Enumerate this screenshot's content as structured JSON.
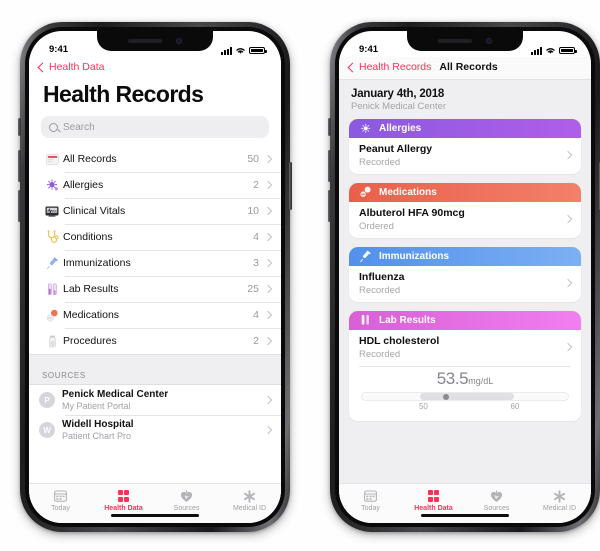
{
  "status_bar": {
    "time": "9:41",
    "signal": "cellular-bars-icon",
    "wifi": "wifi-icon",
    "battery": "battery-icon"
  },
  "theme": {
    "accent": "#fc3158",
    "bg": "#efeff2",
    "allergies": "#9b5de5",
    "medications": "#ef6f52",
    "immunizations": "#5b9bf0",
    "lab_results": "#e46fe0"
  },
  "left_phone": {
    "nav": {
      "back_label": "Health Data",
      "back_icon": "chevron-left-icon"
    },
    "title": "Health Records",
    "search": {
      "placeholder": "Search",
      "icon": "search-icon"
    },
    "categories": [
      {
        "label": "All Records",
        "count": "50",
        "icon": "records-card-icon"
      },
      {
        "label": "Allergies",
        "count": "2",
        "icon": "allergen-icon"
      },
      {
        "label": "Clinical Vitals",
        "count": "10",
        "icon": "monitor-icon"
      },
      {
        "label": "Conditions",
        "count": "4",
        "icon": "stethoscope-icon"
      },
      {
        "label": "Immunizations",
        "count": "3",
        "icon": "syringe-icon"
      },
      {
        "label": "Lab Results",
        "count": "25",
        "icon": "test-tubes-icon"
      },
      {
        "label": "Medications",
        "count": "4",
        "icon": "pills-icon"
      },
      {
        "label": "Procedures",
        "count": "2",
        "icon": "vial-icon"
      }
    ],
    "sources_header": "SOURCES",
    "sources": [
      {
        "initial": "P",
        "name": "Penick Medical Center",
        "sub": "My Patient Portal"
      },
      {
        "initial": "W",
        "name": "Widell Hospital",
        "sub": "Patient Chart Pro"
      }
    ]
  },
  "right_phone": {
    "nav": {
      "back_label": "Health Records",
      "title": "All Records",
      "back_icon": "chevron-left-icon"
    },
    "date": "January 4th, 2018",
    "organization": "Penick Medical Center",
    "cards": [
      {
        "category": "Allergies",
        "icon": "allergen-icon",
        "color": "#9b5de5",
        "entry_title": "Peanut Allergy",
        "entry_status": "Recorded"
      },
      {
        "category": "Medications",
        "icon": "pills-icon",
        "color": "#ef6f52",
        "entry_title": "Albuterol HFA 90mcg",
        "entry_status": "Ordered"
      },
      {
        "category": "Immunizations",
        "icon": "syringe-icon",
        "color": "#5b9bf0",
        "entry_title": "Influenza",
        "entry_status": "Recorded"
      },
      {
        "category": "Lab Results",
        "icon": "test-tubes-icon",
        "color": "#e46fe0",
        "entry_title": "HDL cholesterol",
        "entry_status": "Recorded",
        "gauge": {
          "value": "53.5",
          "unit": "mg/dL",
          "range_low": "50",
          "range_high": "60"
        }
      }
    ]
  },
  "tab_bar": {
    "tabs": [
      {
        "label": "Today",
        "icon": "calendar-icon",
        "active": false
      },
      {
        "label": "Health Data",
        "icon": "health-grid-icon",
        "active": true
      },
      {
        "label": "Sources",
        "icon": "heart-icon",
        "active": false
      },
      {
        "label": "Medical ID",
        "icon": "asterisk-icon",
        "active": false
      }
    ]
  }
}
